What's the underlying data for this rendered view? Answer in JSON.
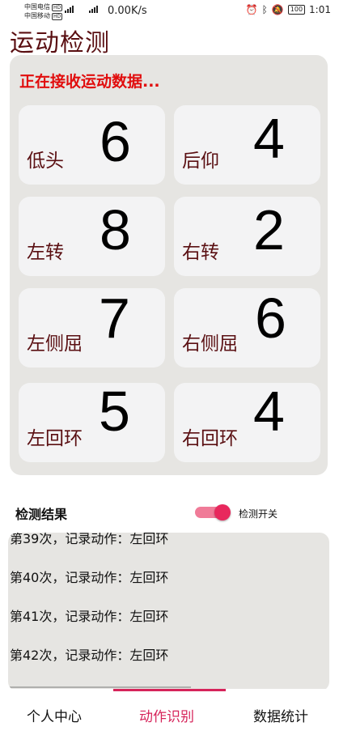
{
  "status_bar": {
    "carrier1": "中国电信",
    "carrier2": "中国移动",
    "hd": "HD",
    "net_type": "4G",
    "net_speed": "0.00K/s",
    "battery": "100",
    "time": "1:01"
  },
  "page": {
    "title": "运动检测"
  },
  "panel": {
    "status_text": "正在接收运动数据...",
    "cards": [
      {
        "label": "低头",
        "count": "6"
      },
      {
        "label": "后仰",
        "count": "4"
      },
      {
        "label": "左转",
        "count": "8"
      },
      {
        "label": "右转",
        "count": "2"
      },
      {
        "label": "左侧屈",
        "count": "7"
      },
      {
        "label": "右侧屈",
        "count": "6"
      },
      {
        "label": "左回环",
        "count": "5"
      },
      {
        "label": "右回环",
        "count": "4"
      }
    ]
  },
  "results": {
    "title": "检测结果",
    "toggle_label": "检测开关",
    "toggle_on": true,
    "accent_color": "#e8285d",
    "log": [
      "第39次，记录动作：左回环",
      "第40次，记录动作：左回环",
      "第41次，记录动作：左回环",
      "第42次，记录动作：左回环"
    ]
  },
  "bottom_nav": {
    "items": [
      "个人中心",
      "动作识别",
      "数据统计"
    ],
    "active_index": 1,
    "active_color": "#d6245a"
  }
}
